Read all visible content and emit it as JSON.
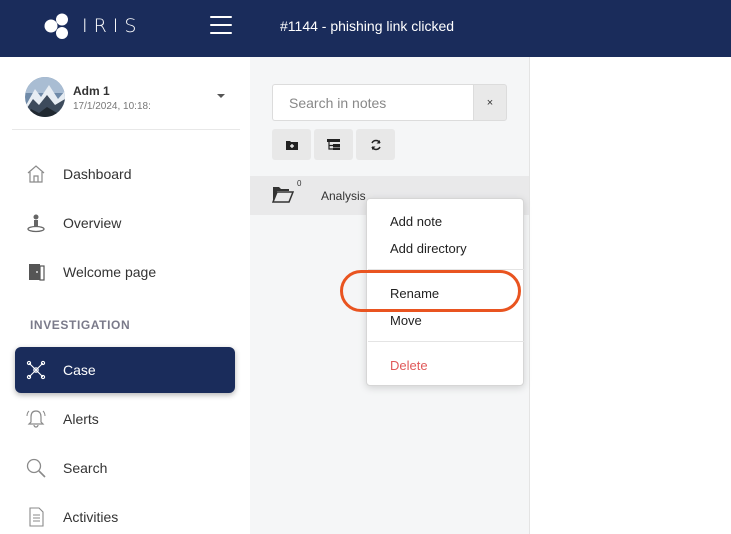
{
  "app": {
    "logo_text": "IRIS",
    "case_title": "#1144 - phishing link clicked"
  },
  "user": {
    "name": "Adm 1",
    "date": "17/1/2024, 10:18:"
  },
  "nav": {
    "items": [
      {
        "label": "Dashboard",
        "icon": "home-icon"
      },
      {
        "label": "Overview",
        "icon": "person-icon"
      },
      {
        "label": "Welcome page",
        "icon": "door-icon"
      }
    ],
    "section_title": "INVESTIGATION",
    "investigation_items": [
      {
        "label": "Case",
        "icon": "network-icon",
        "active": true
      },
      {
        "label": "Alerts",
        "icon": "bell-icon"
      },
      {
        "label": "Search",
        "icon": "search-icon"
      },
      {
        "label": "Activities",
        "icon": "list-icon"
      }
    ]
  },
  "notes": {
    "search_placeholder": "Search in notes",
    "clear_label": "×",
    "toolbar": [
      "add-directory-icon",
      "tree-icon",
      "refresh-icon"
    ],
    "directory": {
      "name": "Analysis",
      "count": "0"
    }
  },
  "context_menu": {
    "add_note": "Add note",
    "add_directory": "Add directory",
    "rename": "Rename",
    "move": "Move",
    "delete": "Delete"
  },
  "colors": {
    "primary": "#1a2c5b",
    "highlight": "#e95420",
    "danger": "#e05a5a"
  }
}
